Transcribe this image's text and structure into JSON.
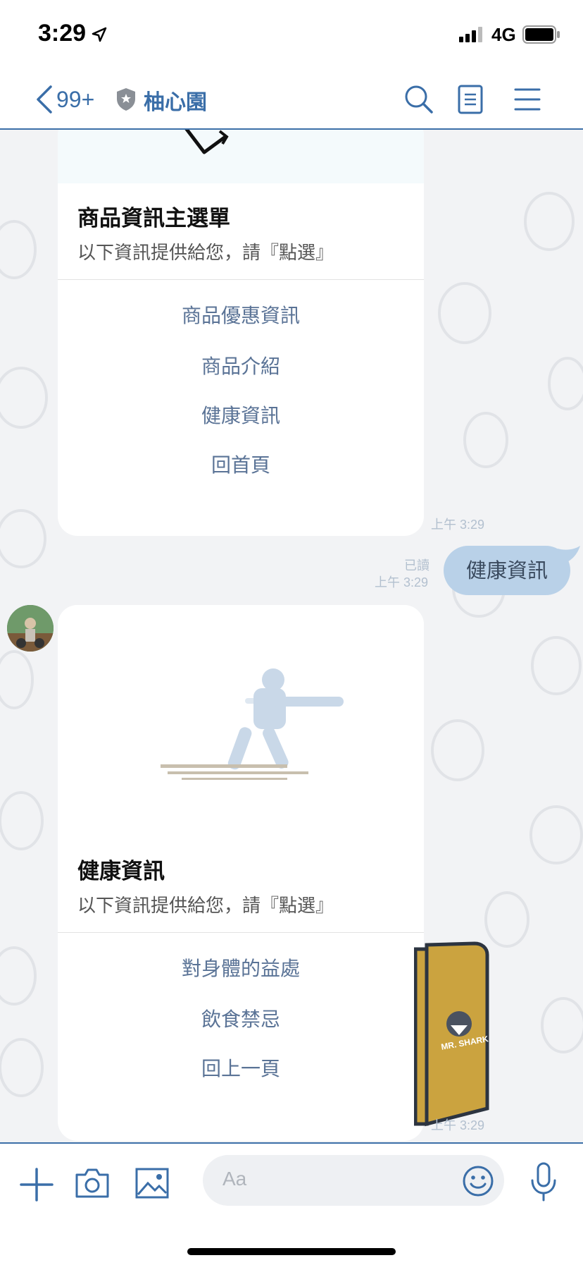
{
  "status_bar": {
    "time": "3:29",
    "network": "4G"
  },
  "nav": {
    "back_count": "99+",
    "chat_name": "柚心園"
  },
  "messages": {
    "card1": {
      "title": "商品資訊主選單",
      "description": "以下資訊提供給您，請『點選』",
      "actions": [
        "商品優惠資訊",
        "商品介紹",
        "健康資訊",
        "回首頁"
      ],
      "timestamp": "上午 3:29"
    },
    "user_message": {
      "text": "健康資訊",
      "read_label": "已讀",
      "timestamp": "上午 3:29"
    },
    "card2": {
      "title": "健康資訊",
      "description": "以下資訊提供給您，請『點選』",
      "actions": [
        "對身體的益處",
        "飲食禁忌",
        "回上一頁"
      ]
    },
    "sticker": {
      "label": "MR. SHARK",
      "timestamp": "上午 3:29"
    }
  },
  "input": {
    "placeholder": "Aa"
  },
  "colors": {
    "accent": "#3a6ea8",
    "bubble": "#b9d1e8",
    "link": "#5a7396"
  }
}
